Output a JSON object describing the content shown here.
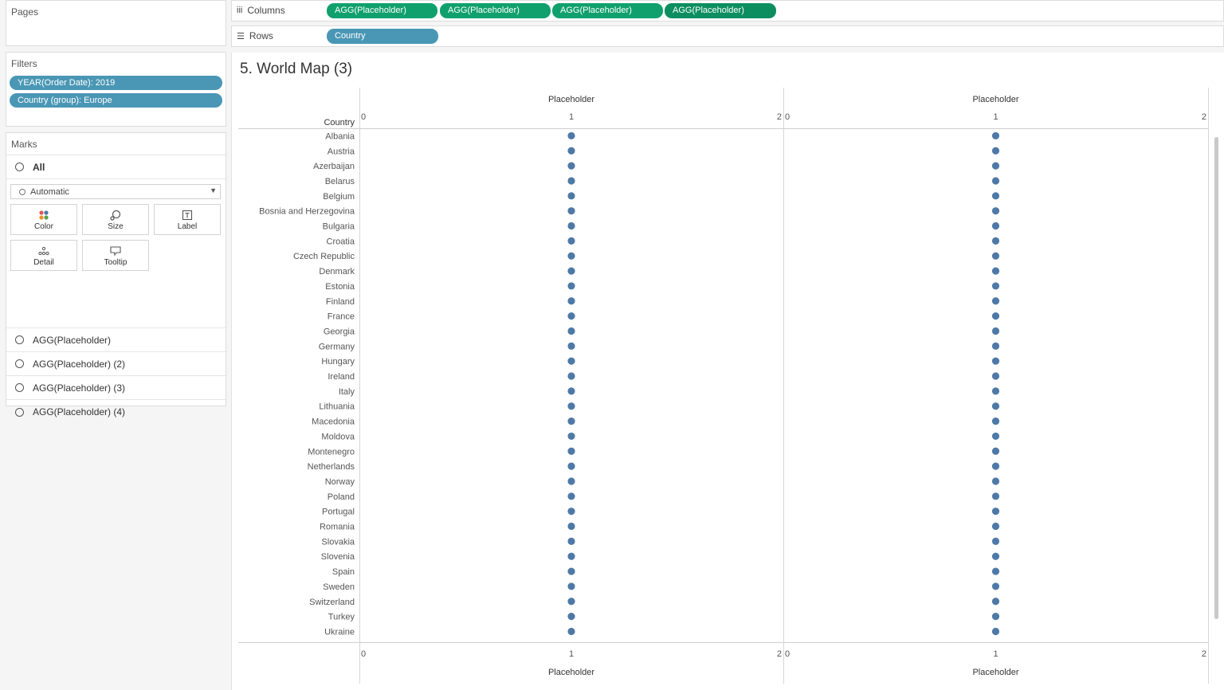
{
  "pages": {
    "title": "Pages"
  },
  "filters": {
    "title": "Filters",
    "items": [
      "YEAR(Order Date): 2019",
      "Country (group): Europe"
    ]
  },
  "marks": {
    "title": "Marks",
    "all_label": "All",
    "mark_type": "Automatic",
    "buttons": {
      "color": "Color",
      "size": "Size",
      "label": "Label",
      "detail": "Detail",
      "tooltip": "Tooltip"
    },
    "measure_cards": [
      "AGG(Placeholder)",
      "AGG(Placeholder) (2)",
      "AGG(Placeholder) (3)",
      "AGG(Placeholder) (4)"
    ]
  },
  "shelves": {
    "columns_label": "Columns",
    "columns_pills": [
      "AGG(Placeholder)",
      "AGG(Placeholder)",
      "AGG(Placeholder)",
      "AGG(Placeholder)"
    ],
    "rows_label": "Rows",
    "rows_pills": [
      "Country"
    ]
  },
  "colors": {
    "mark": "#4e79a7",
    "measure_pill": "#10a06d",
    "dimension_pill": "#4a97b5"
  },
  "sheet": {
    "title": "5. World Map (3)"
  },
  "chart_data": {
    "type": "scatter",
    "row_header": "Country",
    "panes": [
      {
        "axis_title": "Placeholder",
        "xlim": [
          0,
          2
        ],
        "ticks": [
          "0",
          "1",
          "2"
        ],
        "value": 1
      },
      {
        "axis_title": "Placeholder",
        "xlim": [
          0,
          2
        ],
        "ticks": [
          "0",
          "1",
          "2"
        ],
        "value": 1
      }
    ],
    "categories": [
      "Albania",
      "Austria",
      "Azerbaijan",
      "Belarus",
      "Belgium",
      "Bosnia and Herzegovina",
      "Bulgaria",
      "Croatia",
      "Czech Republic",
      "Denmark",
      "Estonia",
      "Finland",
      "France",
      "Georgia",
      "Germany",
      "Hungary",
      "Ireland",
      "Italy",
      "Lithuania",
      "Macedonia",
      "Moldova",
      "Montenegro",
      "Netherlands",
      "Norway",
      "Poland",
      "Portugal",
      "Romania",
      "Slovakia",
      "Slovenia",
      "Spain",
      "Sweden",
      "Switzerland",
      "Turkey",
      "Ukraine"
    ],
    "series": [
      {
        "values": [
          1,
          1,
          1,
          1,
          1,
          1,
          1,
          1,
          1,
          1,
          1,
          1,
          1,
          1,
          1,
          1,
          1,
          1,
          1,
          1,
          1,
          1,
          1,
          1,
          1,
          1,
          1,
          1,
          1,
          1,
          1,
          1,
          1,
          1
        ]
      },
      {
        "values": [
          1,
          1,
          1,
          1,
          1,
          1,
          1,
          1,
          1,
          1,
          1,
          1,
          1,
          1,
          1,
          1,
          1,
          1,
          1,
          1,
          1,
          1,
          1,
          1,
          1,
          1,
          1,
          1,
          1,
          1,
          1,
          1,
          1,
          1
        ]
      }
    ]
  }
}
